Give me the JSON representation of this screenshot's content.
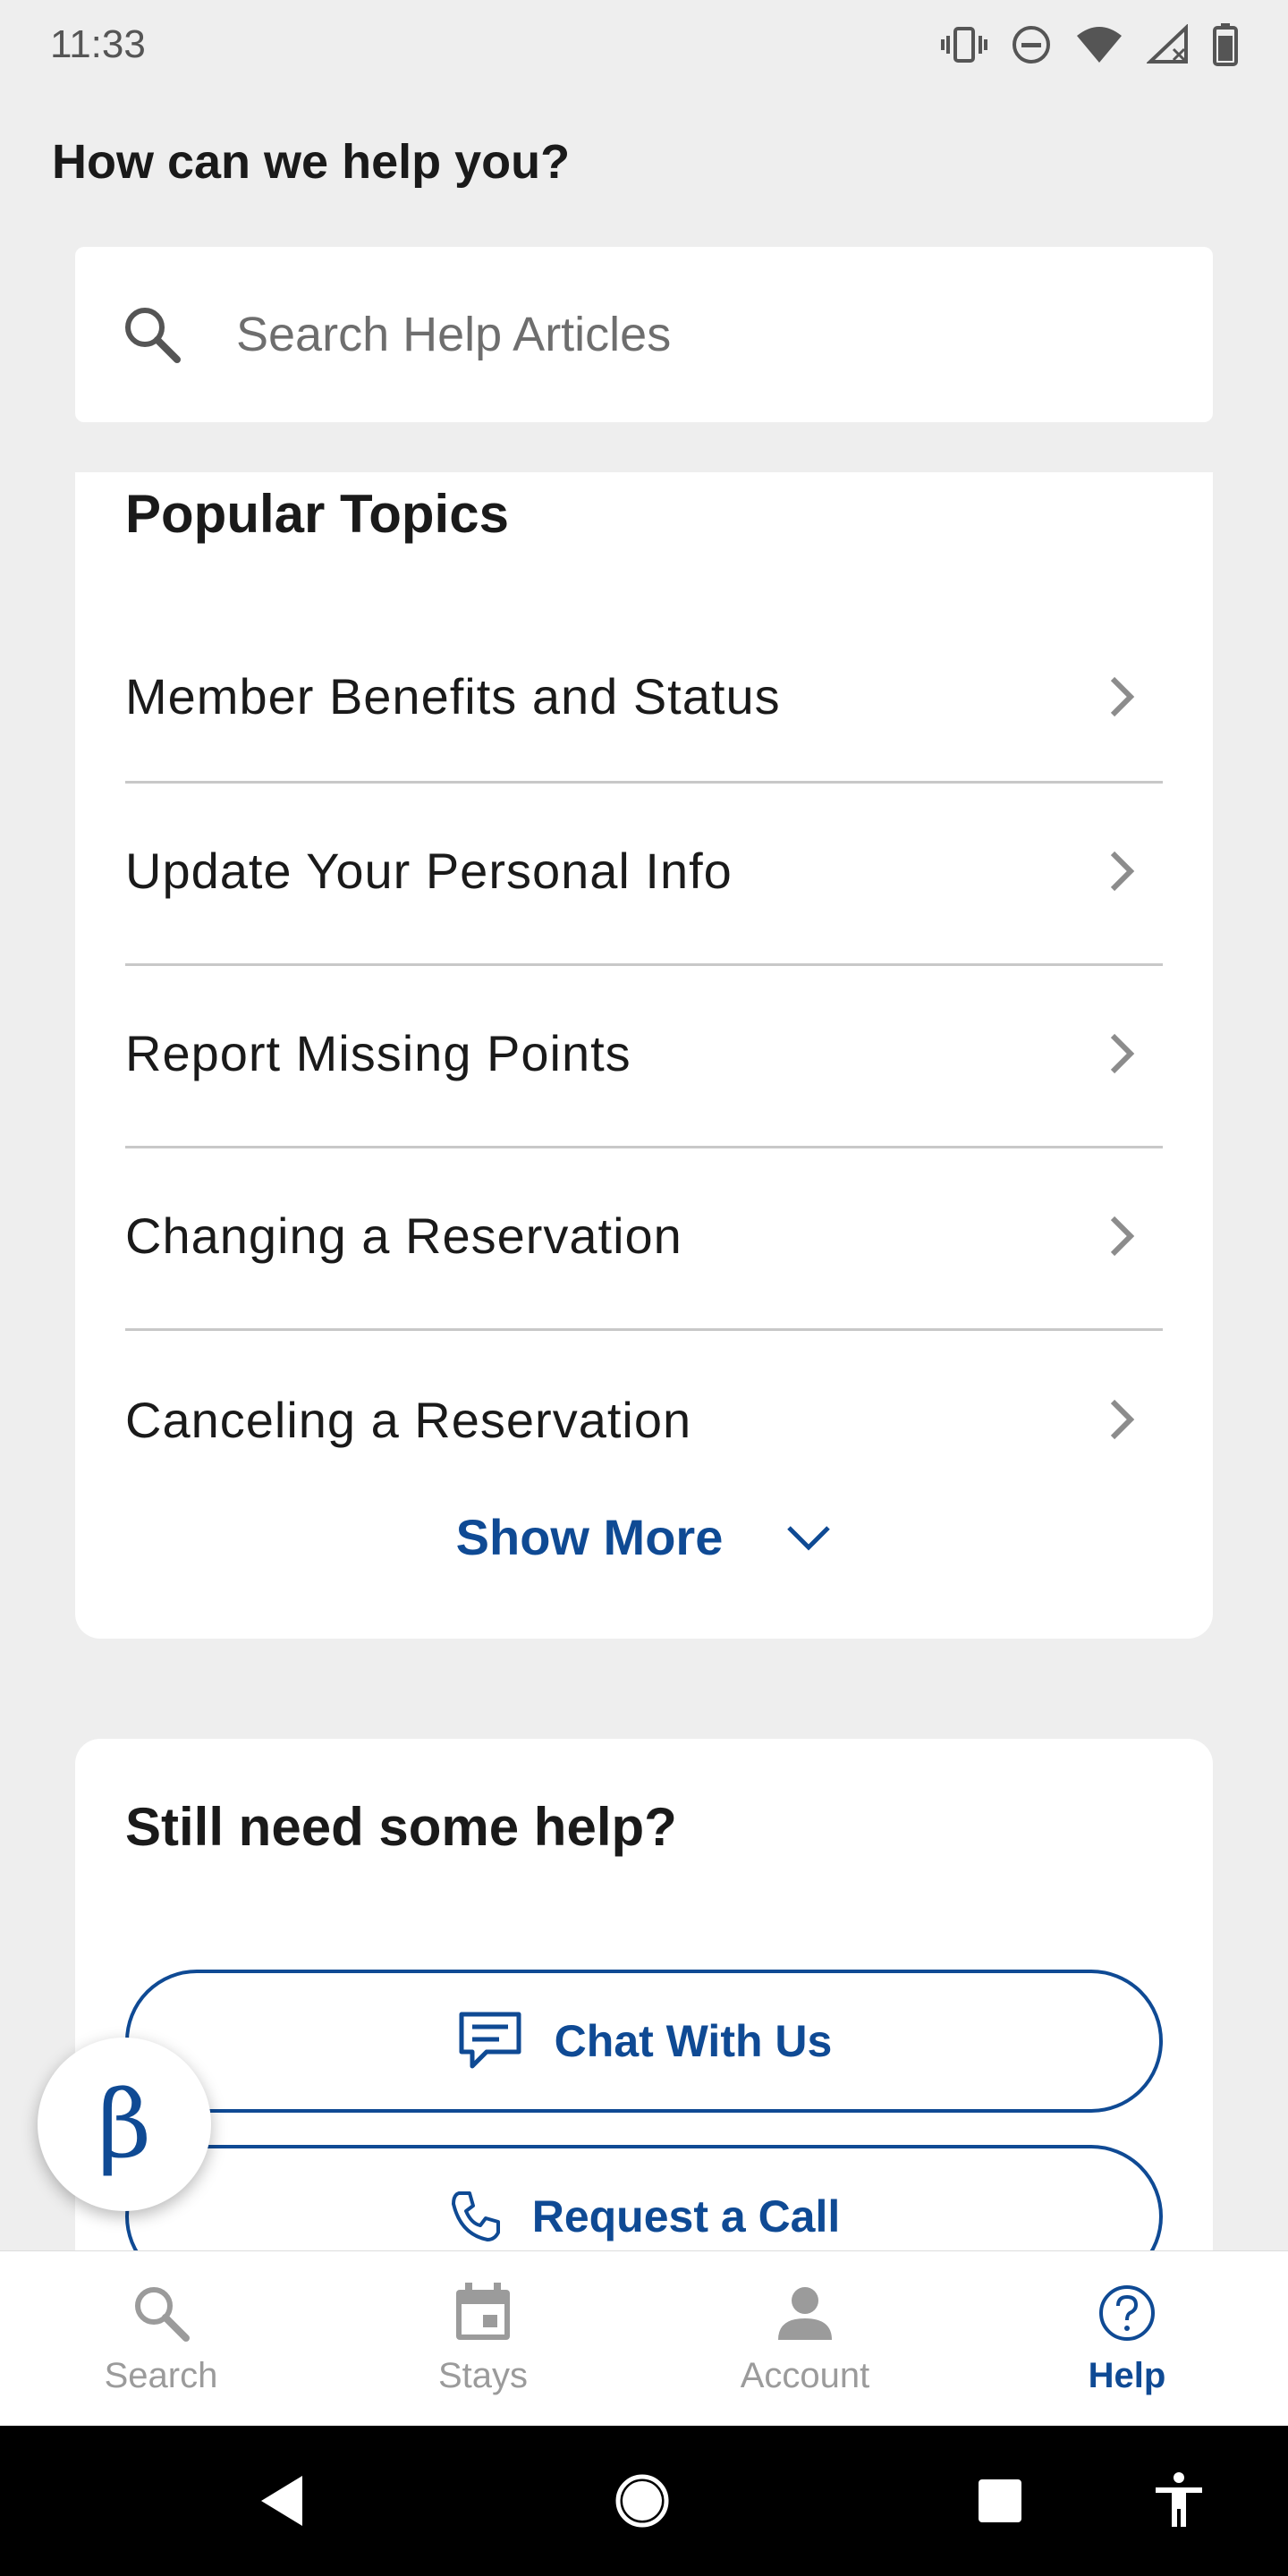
{
  "status_bar": {
    "time": "11:33",
    "icons": [
      "vibrate-icon",
      "do-not-disturb-icon",
      "wifi-icon",
      "cell-signal-icon",
      "battery-icon"
    ]
  },
  "page_title": "How can we help you?",
  "search": {
    "placeholder": "Search Help Articles",
    "icon": "search-icon"
  },
  "popular_topics": {
    "title": "Popular Topics",
    "items": [
      {
        "label": "Member Benefits and Status"
      },
      {
        "label": "Update Your Personal Info"
      },
      {
        "label": "Report Missing Points"
      },
      {
        "label": "Changing a Reservation"
      },
      {
        "label": "Canceling a Reservation"
      }
    ],
    "show_more_label": "Show More"
  },
  "help": {
    "title": "Still need some help?",
    "chat_label": "Chat With Us",
    "call_label": "Request a Call"
  },
  "beta_label": "β",
  "bottom_nav": {
    "items": [
      {
        "label": "Search",
        "icon": "search-icon",
        "active": false
      },
      {
        "label": "Stays",
        "icon": "calendar-icon",
        "active": false
      },
      {
        "label": "Account",
        "icon": "person-icon",
        "active": false
      },
      {
        "label": "Help",
        "icon": "help-circle-icon",
        "active": true
      }
    ]
  },
  "colors": {
    "accent": "#0f4a94",
    "background": "#eeeeee",
    "card": "#ffffff",
    "inactive": "#9b9b9b"
  }
}
